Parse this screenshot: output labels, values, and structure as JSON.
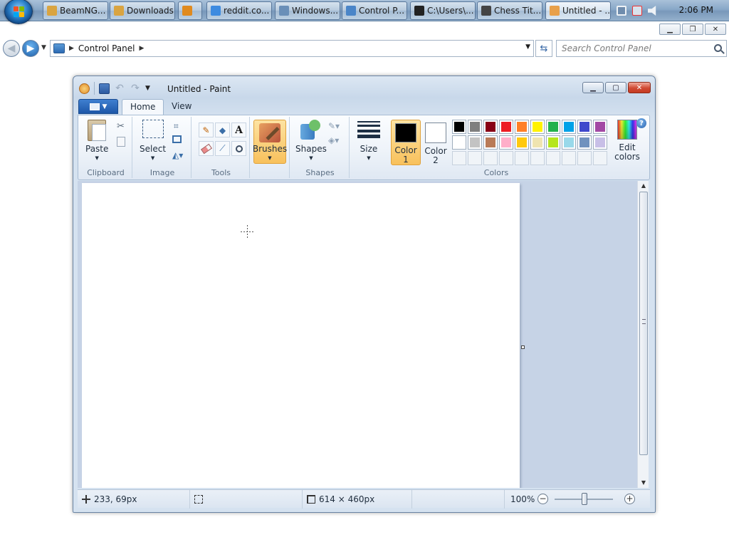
{
  "taskbar": {
    "items": [
      {
        "label": "BeamNG...",
        "icon": "folder-icon",
        "color": "#d9a441"
      },
      {
        "label": "Downloads",
        "icon": "folder-icon",
        "color": "#d9a441"
      },
      {
        "label": "",
        "icon": "media-player-icon",
        "color": "#e08a1e"
      },
      {
        "label": "reddit.co...",
        "icon": "chrome-icon",
        "color": "#3d8be0"
      },
      {
        "label": "Windows...",
        "icon": "windows-explorer-icon",
        "color": "#6a8fb8"
      },
      {
        "label": "Control P...",
        "icon": "control-panel-icon",
        "color": "#4a85c8"
      },
      {
        "label": "C:\\Users\\...",
        "icon": "command-prompt-icon",
        "color": "#222222"
      },
      {
        "label": "Chess Tit...",
        "icon": "chess-icon",
        "color": "#444444"
      },
      {
        "label": "Untitled - ...",
        "icon": "paint-icon",
        "color": "#e8a04a"
      }
    ],
    "clock": "2:06 PM"
  },
  "explorer": {
    "breadcrumb": "Control Panel",
    "search_placeholder": "Search Control Panel"
  },
  "paint": {
    "title": "Untitled - Paint",
    "tabs": [
      "Home",
      "View"
    ],
    "groups": {
      "clipboard": "Clipboard",
      "image": "Image",
      "tools": "Tools",
      "shapes": "Shapes",
      "colors": "Colors"
    },
    "buttons": {
      "paste": "Paste",
      "select": "Select",
      "brushes": "Brushes",
      "shapes": "Shapes",
      "size": "Size",
      "color1_line1": "Color",
      "color1_line2": "1",
      "color2_line1": "Color",
      "color2_line2": "2",
      "edit_colors_line1": "Edit",
      "edit_colors_line2": "colors"
    },
    "color1": "#000000",
    "color2": "#ffffff",
    "palette": [
      "#000000",
      "#7f7f7f",
      "#880015",
      "#ed1c24",
      "#ff7f27",
      "#fff200",
      "#22b14c",
      "#00a2e8",
      "#3f48cc",
      "#a349a4",
      "#ffffff",
      "#c3c3c3",
      "#b97a57",
      "#ffaec9",
      "#ffc90e",
      "#efe4b0",
      "#b5e61d",
      "#99d9ea",
      "#7092be",
      "#c8bfe7"
    ],
    "status": {
      "cursor_position": "233, 69px",
      "canvas_size": "614 × 460px",
      "zoom": "100%"
    }
  }
}
